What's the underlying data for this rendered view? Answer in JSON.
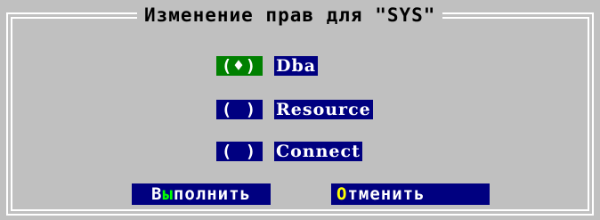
{
  "dialog": {
    "title": "Изменение прав для \"SYS\""
  },
  "options": [
    {
      "mark": "(♦)",
      "label": "Dba",
      "checked": true
    },
    {
      "mark": "( )",
      "label": "Resource",
      "checked": false
    },
    {
      "mark": "( )",
      "label": "Connect",
      "checked": false
    }
  ],
  "buttons": {
    "execute": {
      "hotkey": "ы",
      "prefix": "В",
      "rest": "полнить"
    },
    "cancel": {
      "hotkey": "О",
      "rest": "тменить"
    }
  },
  "colors": {
    "background": "#c0c0c0",
    "selection": "#000080",
    "checked": "#008000",
    "hotkey_green": "#00ff00",
    "hotkey_yellow": "#ffff00"
  }
}
